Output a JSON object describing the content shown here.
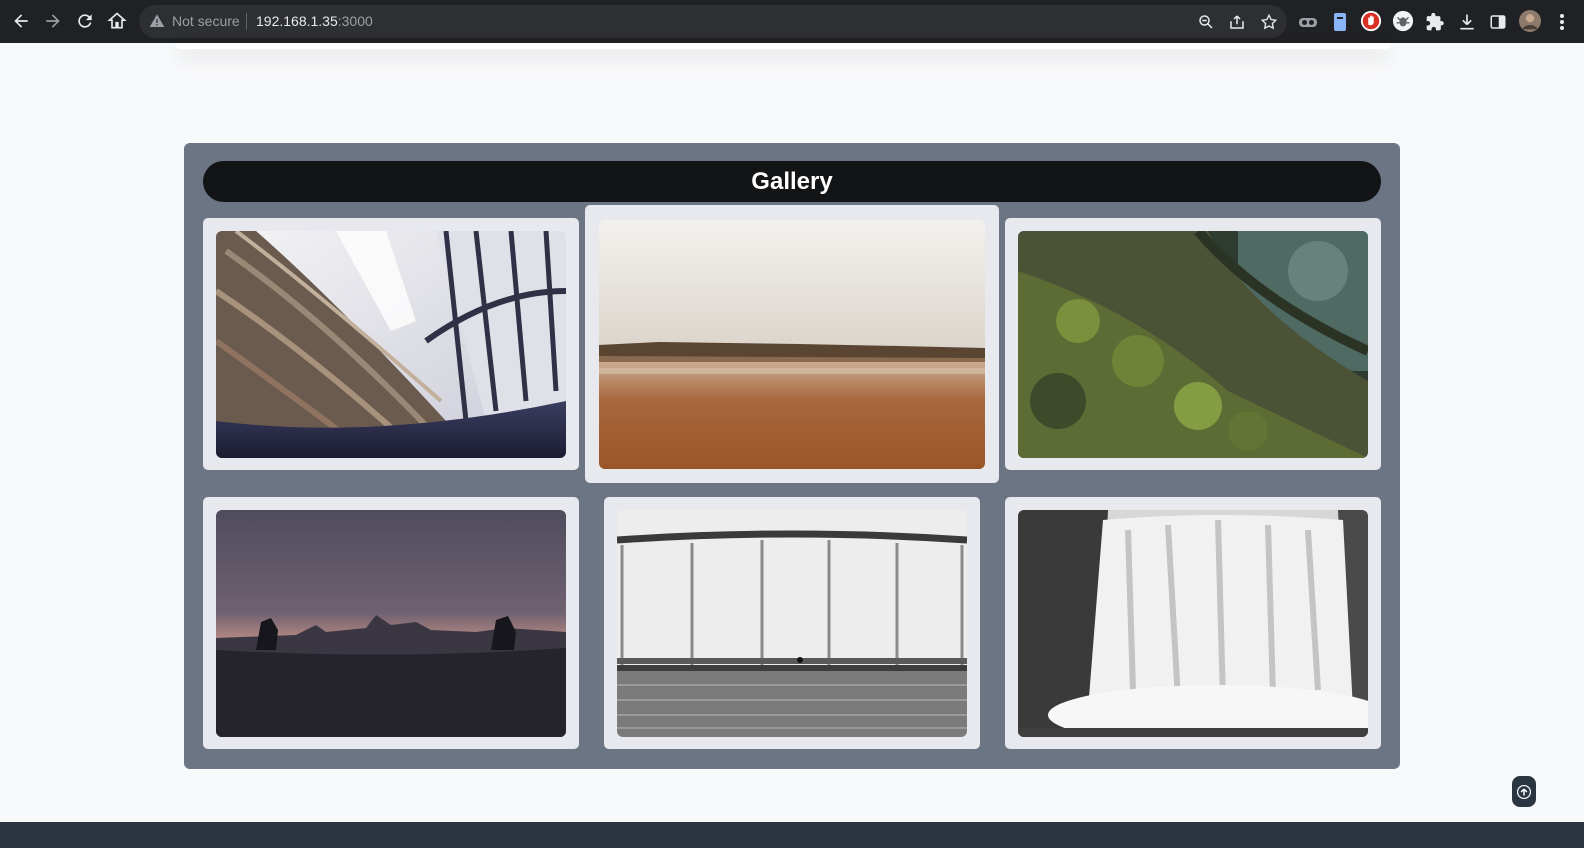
{
  "browser": {
    "security_label": "Not secure",
    "url_host": "192.168.1.35",
    "url_port": ":3000"
  },
  "gallery": {
    "title": "Gallery",
    "items": [
      {
        "subject": "library-bookshelves"
      },
      {
        "subject": "desert-lake-landscape"
      },
      {
        "subject": "mossy-tree-bark"
      },
      {
        "subject": "bridge-at-dusk-statues"
      },
      {
        "subject": "bridge-cyclist-river"
      },
      {
        "subject": "waterfall"
      }
    ]
  },
  "colors": {
    "section_bg": "#6c7583",
    "title_bg": "#121416",
    "card_bg": "#e8e9ee",
    "footer_bg": "#2b3542"
  }
}
